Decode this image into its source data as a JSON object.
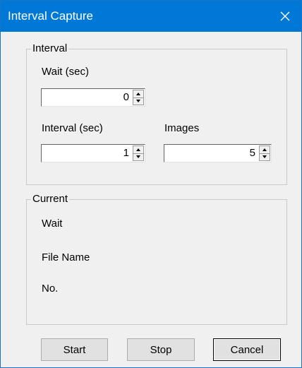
{
  "window": {
    "title": "Interval Capture",
    "close_icon": "close-icon"
  },
  "interval_group": {
    "title": "Interval",
    "wait_label": "Wait (sec)",
    "wait_value": "0",
    "interval_label": "Interval (sec)",
    "interval_value": "1",
    "images_label": "Images",
    "images_value": "5"
  },
  "current_group": {
    "title": "Current",
    "wait_label": "Wait",
    "file_name_label": "File Name",
    "number_label": "No."
  },
  "buttons": {
    "start": "Start",
    "stop": "Stop",
    "cancel": "Cancel"
  },
  "colors": {
    "title_bar": "#0078d7",
    "window_bg": "#f0f0f0"
  }
}
